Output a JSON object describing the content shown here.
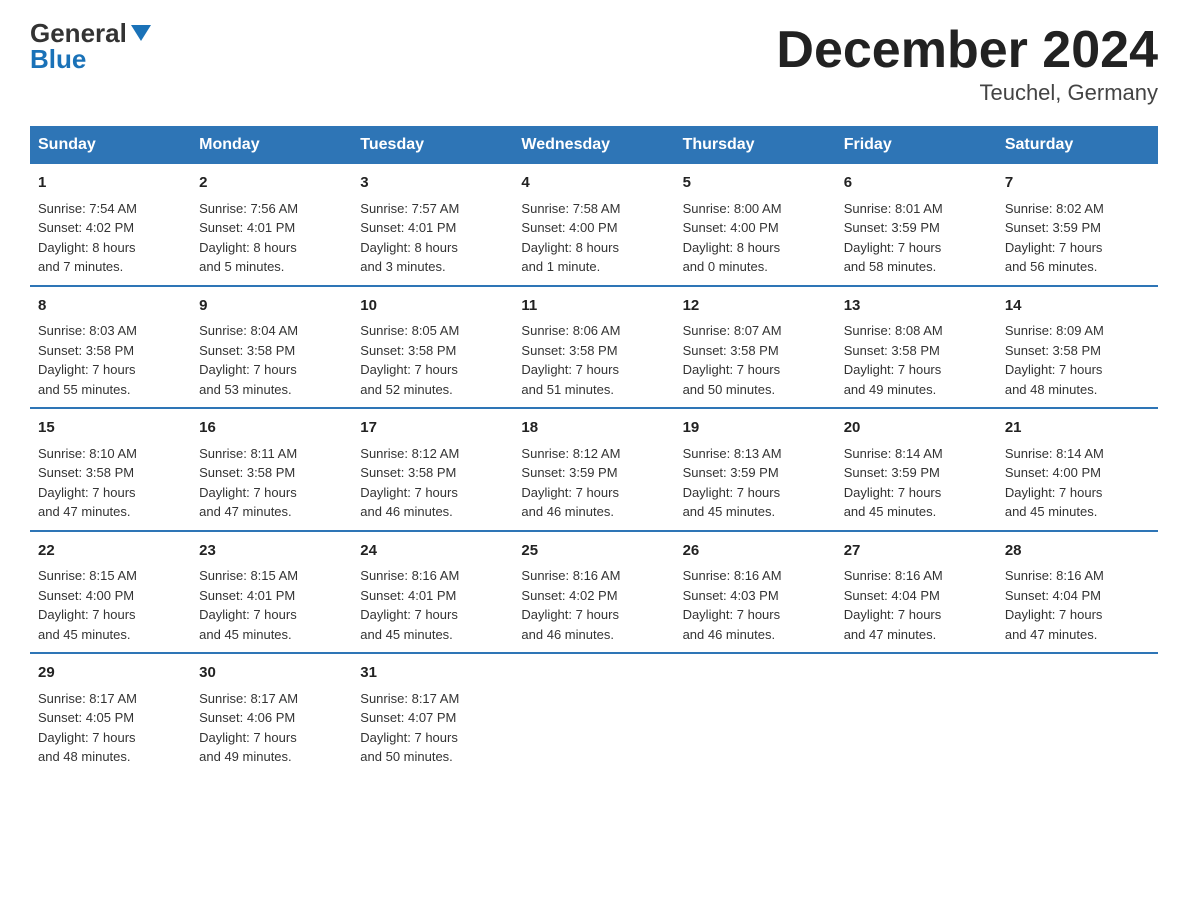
{
  "logo": {
    "general": "General",
    "blue": "Blue",
    "triangle": "▲"
  },
  "title": "December 2024",
  "subtitle": "Teuchel, Germany",
  "days_of_week": [
    "Sunday",
    "Monday",
    "Tuesday",
    "Wednesday",
    "Thursday",
    "Friday",
    "Saturday"
  ],
  "weeks": [
    [
      {
        "day": "1",
        "sunrise": "7:54 AM",
        "sunset": "4:02 PM",
        "daylight": "8 hours and 7 minutes."
      },
      {
        "day": "2",
        "sunrise": "7:56 AM",
        "sunset": "4:01 PM",
        "daylight": "8 hours and 5 minutes."
      },
      {
        "day": "3",
        "sunrise": "7:57 AM",
        "sunset": "4:01 PM",
        "daylight": "8 hours and 3 minutes."
      },
      {
        "day": "4",
        "sunrise": "7:58 AM",
        "sunset": "4:00 PM",
        "daylight": "8 hours and 1 minute."
      },
      {
        "day": "5",
        "sunrise": "8:00 AM",
        "sunset": "4:00 PM",
        "daylight": "8 hours and 0 minutes."
      },
      {
        "day": "6",
        "sunrise": "8:01 AM",
        "sunset": "3:59 PM",
        "daylight": "7 hours and 58 minutes."
      },
      {
        "day": "7",
        "sunrise": "8:02 AM",
        "sunset": "3:59 PM",
        "daylight": "7 hours and 56 minutes."
      }
    ],
    [
      {
        "day": "8",
        "sunrise": "8:03 AM",
        "sunset": "3:58 PM",
        "daylight": "7 hours and 55 minutes."
      },
      {
        "day": "9",
        "sunrise": "8:04 AM",
        "sunset": "3:58 PM",
        "daylight": "7 hours and 53 minutes."
      },
      {
        "day": "10",
        "sunrise": "8:05 AM",
        "sunset": "3:58 PM",
        "daylight": "7 hours and 52 minutes."
      },
      {
        "day": "11",
        "sunrise": "8:06 AM",
        "sunset": "3:58 PM",
        "daylight": "7 hours and 51 minutes."
      },
      {
        "day": "12",
        "sunrise": "8:07 AM",
        "sunset": "3:58 PM",
        "daylight": "7 hours and 50 minutes."
      },
      {
        "day": "13",
        "sunrise": "8:08 AM",
        "sunset": "3:58 PM",
        "daylight": "7 hours and 49 minutes."
      },
      {
        "day": "14",
        "sunrise": "8:09 AM",
        "sunset": "3:58 PM",
        "daylight": "7 hours and 48 minutes."
      }
    ],
    [
      {
        "day": "15",
        "sunrise": "8:10 AM",
        "sunset": "3:58 PM",
        "daylight": "7 hours and 47 minutes."
      },
      {
        "day": "16",
        "sunrise": "8:11 AM",
        "sunset": "3:58 PM",
        "daylight": "7 hours and 47 minutes."
      },
      {
        "day": "17",
        "sunrise": "8:12 AM",
        "sunset": "3:58 PM",
        "daylight": "7 hours and 46 minutes."
      },
      {
        "day": "18",
        "sunrise": "8:12 AM",
        "sunset": "3:59 PM",
        "daylight": "7 hours and 46 minutes."
      },
      {
        "day": "19",
        "sunrise": "8:13 AM",
        "sunset": "3:59 PM",
        "daylight": "7 hours and 45 minutes."
      },
      {
        "day": "20",
        "sunrise": "8:14 AM",
        "sunset": "3:59 PM",
        "daylight": "7 hours and 45 minutes."
      },
      {
        "day": "21",
        "sunrise": "8:14 AM",
        "sunset": "4:00 PM",
        "daylight": "7 hours and 45 minutes."
      }
    ],
    [
      {
        "day": "22",
        "sunrise": "8:15 AM",
        "sunset": "4:00 PM",
        "daylight": "7 hours and 45 minutes."
      },
      {
        "day": "23",
        "sunrise": "8:15 AM",
        "sunset": "4:01 PM",
        "daylight": "7 hours and 45 minutes."
      },
      {
        "day": "24",
        "sunrise": "8:16 AM",
        "sunset": "4:01 PM",
        "daylight": "7 hours and 45 minutes."
      },
      {
        "day": "25",
        "sunrise": "8:16 AM",
        "sunset": "4:02 PM",
        "daylight": "7 hours and 46 minutes."
      },
      {
        "day": "26",
        "sunrise": "8:16 AM",
        "sunset": "4:03 PM",
        "daylight": "7 hours and 46 minutes."
      },
      {
        "day": "27",
        "sunrise": "8:16 AM",
        "sunset": "4:04 PM",
        "daylight": "7 hours and 47 minutes."
      },
      {
        "day": "28",
        "sunrise": "8:16 AM",
        "sunset": "4:04 PM",
        "daylight": "7 hours and 47 minutes."
      }
    ],
    [
      {
        "day": "29",
        "sunrise": "8:17 AM",
        "sunset": "4:05 PM",
        "daylight": "7 hours and 48 minutes."
      },
      {
        "day": "30",
        "sunrise": "8:17 AM",
        "sunset": "4:06 PM",
        "daylight": "7 hours and 49 minutes."
      },
      {
        "day": "31",
        "sunrise": "8:17 AM",
        "sunset": "4:07 PM",
        "daylight": "7 hours and 50 minutes."
      },
      {
        "day": "",
        "sunrise": "",
        "sunset": "",
        "daylight": ""
      },
      {
        "day": "",
        "sunrise": "",
        "sunset": "",
        "daylight": ""
      },
      {
        "day": "",
        "sunrise": "",
        "sunset": "",
        "daylight": ""
      },
      {
        "day": "",
        "sunrise": "",
        "sunset": "",
        "daylight": ""
      }
    ]
  ],
  "labels": {
    "sunrise": "Sunrise:",
    "sunset": "Sunset:",
    "daylight": "Daylight:"
  }
}
